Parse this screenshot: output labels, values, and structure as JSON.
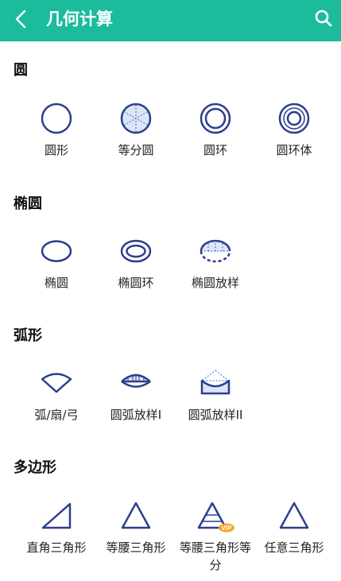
{
  "header": {
    "title": "几何计算",
    "back_icon": "chevron-left-icon",
    "search_icon": "search-icon"
  },
  "colors": {
    "header": "#1ABC9C",
    "icon_stroke": "#2C3E8F",
    "vip_badge": "#F5A623"
  },
  "sections": [
    {
      "title": "圆",
      "items": [
        {
          "label": "圆形",
          "icon": "circle-icon"
        },
        {
          "label": "等分圆",
          "icon": "divided-circle-icon"
        },
        {
          "label": "圆环",
          "icon": "ring-icon"
        },
        {
          "label": "圆环体",
          "icon": "torus-icon"
        }
      ]
    },
    {
      "title": "椭圆",
      "items": [
        {
          "label": "椭圆",
          "icon": "ellipse-icon"
        },
        {
          "label": "椭圆环",
          "icon": "ellipse-ring-icon"
        },
        {
          "label": "椭圆放样",
          "icon": "ellipse-layout-icon"
        }
      ]
    },
    {
      "title": "弧形",
      "items": [
        {
          "label": "弧/扇/弓",
          "icon": "arc-sector-icon"
        },
        {
          "label": "圆弧放样I",
          "icon": "arc-layout-1-icon"
        },
        {
          "label": "圆弧放样II",
          "icon": "arc-layout-2-icon"
        }
      ]
    },
    {
      "title": "多边形",
      "items": [
        {
          "label": "直角三角形",
          "icon": "right-triangle-icon"
        },
        {
          "label": "等腰三角形",
          "icon": "isosceles-triangle-icon"
        },
        {
          "label": "等腰三角形等分",
          "icon": "isosceles-triangle-divided-icon",
          "badge": "VIP"
        },
        {
          "label": "任意三角形",
          "icon": "triangle-icon"
        }
      ]
    }
  ]
}
